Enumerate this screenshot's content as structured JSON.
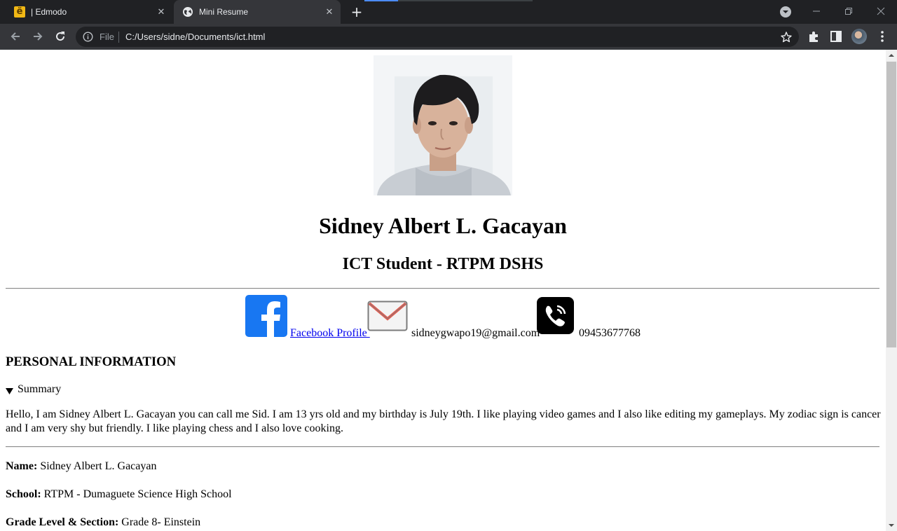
{
  "browser": {
    "tabs": [
      {
        "title": "| Edmodo",
        "favicon": "edmodo-icon",
        "active": false
      },
      {
        "title": "Mini Resume",
        "favicon": "globe-icon",
        "active": true
      }
    ],
    "address": {
      "scheme_label": "File",
      "url": "C:/Users/sidne/Documents/ict.html"
    }
  },
  "page": {
    "photo_alt": "profile-photo",
    "name": "Sidney Albert L. Gacayan",
    "subtitle": "ICT Student - RTPM DSHS",
    "contacts": {
      "facebook_label": "Facebook Profile ",
      "email": "sidneygwapo19@gmail.com",
      "phone": "09453677768"
    },
    "section_title": "PERSONAL INFORMATION",
    "summary_label": "Summary",
    "summary_text": "Hello, I am Sidney Albert L. Gacayan you can call me Sid. I am 13 yrs old and my birthday is July 19th. I like playing video games and I also like editing my gameplays. My zodiac sign is cancer and I am very shy but friendly. I like playing chess and I also love cooking.",
    "fields": [
      {
        "label": "Name:",
        "value": "Sidney Albert L. Gacayan"
      },
      {
        "label": "School:",
        "value": "RTPM - Dumaguete Science High School"
      },
      {
        "label": "Grade Level & Section:",
        "value": "Grade 8- Einstein"
      }
    ]
  },
  "colors": {
    "link": "#0000ee",
    "facebook": "#1877f2",
    "chrome_dark": "#202124",
    "chrome_toolbar": "#35363a"
  }
}
